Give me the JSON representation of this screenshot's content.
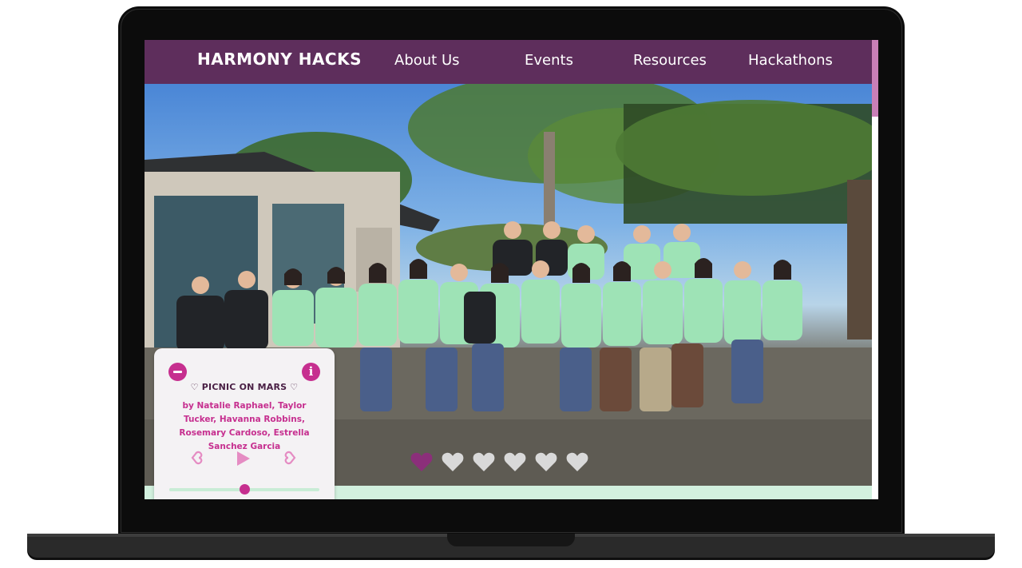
{
  "brand": {
    "name": "HARMONY HACKS"
  },
  "nav": {
    "items": [
      "About Us",
      "Events",
      "Resources",
      "Hackathons"
    ]
  },
  "colors": {
    "nav_bg": "#5e2e5c",
    "accent": "#c62f8f",
    "heart_active": "#8b2f7a",
    "heart_inactive": "#d9d9d9",
    "mint": "#d2f0de"
  },
  "carousel": {
    "total": 6,
    "active_index": 0
  },
  "player": {
    "title": "♡ PICNIC ON MARS ♡",
    "artists": "by Natalie Raphael, Taylor Tucker, Havanna Robbins, Rosemary Cardoso, Estrella Sanchez Garcia",
    "progress": 0.5,
    "icons": {
      "minimize": "minus-circle-icon",
      "info": "info-circle-icon",
      "prev": "heart-prev-icon",
      "play": "play-icon",
      "next": "heart-next-icon"
    }
  }
}
